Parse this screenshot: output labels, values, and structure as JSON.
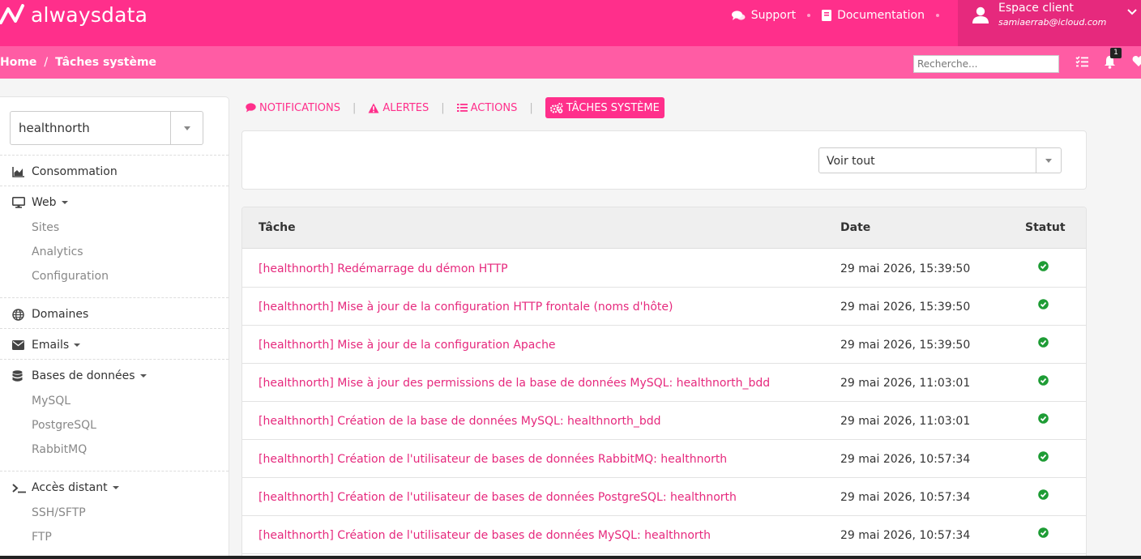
{
  "brand": {
    "name": "alwaysdata",
    "accent": "#ff2f8b"
  },
  "topnav": {
    "support": "Support",
    "documentation": "Documentation",
    "account_title": "Espace client",
    "account_email": "samiaerrab@icloud.com"
  },
  "breadcrumb": {
    "home": "Home",
    "separator": "/",
    "current": "Tâches système"
  },
  "search": {
    "placeholder": "Recherche..."
  },
  "notifications_count": "1",
  "sidebar": {
    "account_select": "healthnorth",
    "sections": [
      {
        "label": "Consommation",
        "icon": "chart-area-icon",
        "dropdown": false,
        "subitems": []
      },
      {
        "label": "Web",
        "icon": "desktop-icon",
        "dropdown": true,
        "subitems": [
          "Sites",
          "Analytics",
          "Configuration"
        ]
      },
      {
        "label": "Domaines",
        "icon": "globe-icon",
        "dropdown": false,
        "subitems": []
      },
      {
        "label": "Emails",
        "icon": "envelope-icon",
        "dropdown": true,
        "subitems": []
      },
      {
        "label": "Bases de données",
        "icon": "database-icon",
        "dropdown": true,
        "subitems": [
          "MySQL",
          "PostgreSQL",
          "RabbitMQ"
        ]
      },
      {
        "label": "Accès distant",
        "icon": "terminal-icon",
        "dropdown": true,
        "subitems": [
          "SSH/SFTP",
          "FTP"
        ]
      }
    ]
  },
  "tabs": {
    "notifications": "NOTIFICATIONS",
    "alertes": "ALERTES",
    "actions": "ACTIONS",
    "taches": "TÂCHES SYSTÈME",
    "separator": "|"
  },
  "filter": {
    "selected": "Voir tout"
  },
  "table": {
    "headers": {
      "task": "Tâche",
      "date": "Date",
      "status": "Statut"
    },
    "rows": [
      {
        "task": "[healthnorth] Redémarrage du démon HTTP",
        "date": "29 mai 2026, 15:39:50",
        "status": "success"
      },
      {
        "task": "[healthnorth] Mise à jour de la configuration HTTP frontale (noms d'hôte)",
        "date": "29 mai 2026, 15:39:50",
        "status": "success"
      },
      {
        "task": "[healthnorth] Mise à jour de la configuration Apache",
        "date": "29 mai 2026, 15:39:50",
        "status": "success"
      },
      {
        "task": "[healthnorth] Mise à jour des permissions de la base de données MySQL: healthnorth_bdd",
        "date": "29 mai 2026, 11:03:01",
        "status": "success"
      },
      {
        "task": "[healthnorth] Création de la base de données MySQL: healthnorth_bdd",
        "date": "29 mai 2026, 11:03:01",
        "status": "success"
      },
      {
        "task": "[healthnorth] Création de l'utilisateur de bases de données RabbitMQ: healthnorth",
        "date": "29 mai 2026, 10:57:34",
        "status": "success"
      },
      {
        "task": "[healthnorth] Création de l'utilisateur de bases de données PostgreSQL: healthnorth",
        "date": "29 mai 2026, 10:57:34",
        "status": "success"
      },
      {
        "task": "[healthnorth] Création de l'utilisateur de bases de données MySQL: healthnorth",
        "date": "29 mai 2026, 10:57:34",
        "status": "success"
      }
    ]
  }
}
